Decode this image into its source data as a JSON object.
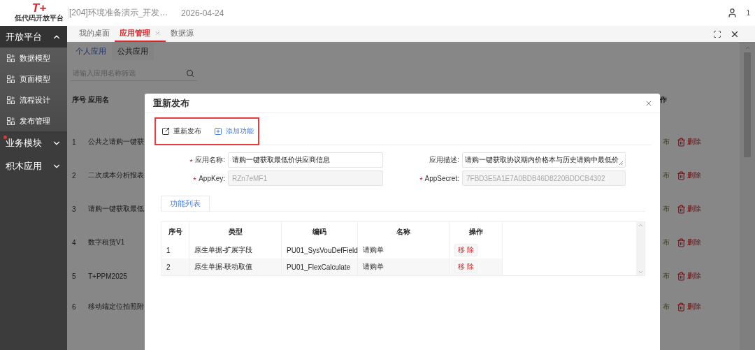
{
  "header": {
    "logo_mark": "T+",
    "logo_text": "低代码开放平台",
    "context": "[204]环境准备演示_开发…",
    "date": "2026-04-24",
    "user_count": "1"
  },
  "sidebar": {
    "groups": [
      {
        "label": "开放平台",
        "expanded": true,
        "badge": false,
        "children": [
          {
            "label": "数据模型"
          },
          {
            "label": "页面模型"
          },
          {
            "label": "流程设计"
          },
          {
            "label": "发布管理"
          }
        ]
      },
      {
        "label": "业务模块",
        "expanded": false,
        "badge": true
      },
      {
        "label": "积木应用",
        "expanded": false,
        "badge": false
      }
    ]
  },
  "tabs": [
    {
      "label": "我的桌面",
      "selected": false,
      "closable": false
    },
    {
      "label": "应用管理",
      "selected": true,
      "closable": true
    },
    {
      "label": "数据源",
      "selected": false,
      "closable": false
    }
  ],
  "page": {
    "subtabs": [
      {
        "label": "个人应用",
        "selected": true
      },
      {
        "label": "公共应用",
        "selected": false
      }
    ],
    "search": {
      "placeholder": "请输入应用名称筛选"
    },
    "table": {
      "columns": [
        "序号",
        "应用名",
        "作"
      ],
      "rows": [
        {
          "index": "1",
          "name": "公共之请购一键获",
          "publish": "布",
          "delete": "删除"
        },
        {
          "index": "2",
          "name": "二次成本分析报表",
          "publish": "布",
          "delete": "删除"
        },
        {
          "index": "3",
          "name": "请购一键获取最低",
          "publish": "布",
          "delete": "删除"
        },
        {
          "index": "4",
          "name": "数字租赁V1",
          "publish": "布",
          "delete": "删除"
        },
        {
          "index": "5",
          "name": "T+PPM2025",
          "publish": "布",
          "delete": "删除"
        },
        {
          "index": "6",
          "name": "移动端定位拍照附",
          "publish": "布",
          "delete": "删除"
        }
      ]
    }
  },
  "dialog": {
    "title": "重新发布",
    "toolbar": [
      {
        "label": "重新发布",
        "kind": "publish"
      },
      {
        "label": "添加功能",
        "kind": "add"
      }
    ],
    "fields": [
      {
        "label": "应用名称:",
        "required": true,
        "value": "请购一键获取最低价供应商信息",
        "disabled": false,
        "kind": "input"
      },
      {
        "label": "应用描述:",
        "required": false,
        "value": "请购一键获取协议期内价格本与历史请购中最低价",
        "disabled": false,
        "kind": "textarea"
      },
      {
        "label": "AppKey:",
        "required": true,
        "value": "RZn7eMF1",
        "disabled": true,
        "kind": "input"
      },
      {
        "label": "AppSecret:",
        "required": true,
        "value": "7FBD3E5A1E7A0BDB46D8220BDDCB4302",
        "disabled": true,
        "kind": "input"
      }
    ],
    "tabs": [
      {
        "label": "功能列表",
        "selected": true
      }
    ],
    "table": {
      "columns": [
        "序号",
        "类型",
        "编码",
        "名称",
        "操作"
      ],
      "rows": [
        {
          "index": "1",
          "type": "原生单据-扩展字段",
          "code": "PU01_SysVouDefField",
          "name": "请购单",
          "action": "移 除"
        },
        {
          "index": "2",
          "type": "原生单据-联动取值",
          "code": "PU01_FlexCalculate",
          "name": "请购单",
          "action": "移 除"
        }
      ]
    }
  }
}
